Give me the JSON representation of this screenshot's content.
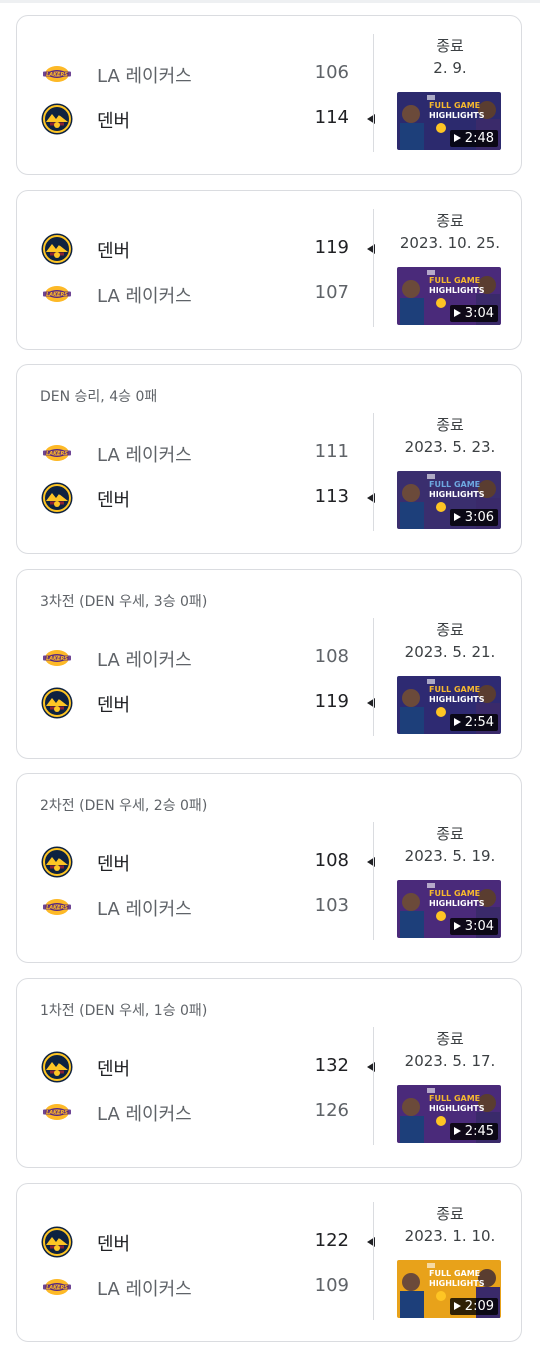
{
  "games": [
    {
      "label": "",
      "status": "종료",
      "date": "2. 9.",
      "teams": [
        {
          "name": "LA 레이커스",
          "score": "106",
          "logo": "lakers-logo",
          "winner": false
        },
        {
          "name": "덴버",
          "score": "114",
          "logo": "nuggets-logo",
          "winner": true
        }
      ],
      "video": {
        "duration": "2:48",
        "line1": "FULL GAME",
        "line2": "HIGHLIGHTS",
        "bg": "#2c2a6e",
        "accent": "#f5b82e"
      }
    },
    {
      "label": "",
      "status": "종료",
      "date": "2023. 10. 25.",
      "teams": [
        {
          "name": "덴버",
          "score": "119",
          "logo": "nuggets-logo",
          "winner": true
        },
        {
          "name": "LA 레이커스",
          "score": "107",
          "logo": "lakers-logo",
          "winner": false
        }
      ],
      "video": {
        "duration": "3:04",
        "line1": "FULL GAME",
        "line2": "HIGHLIGHTS",
        "bg": "#4a2a7a",
        "accent": "#f5b82e"
      }
    },
    {
      "label": "DEN 승리, 4승 0패",
      "status": "종료",
      "date": "2023. 5. 23.",
      "teams": [
        {
          "name": "LA 레이커스",
          "score": "111",
          "logo": "lakers-logo",
          "winner": false
        },
        {
          "name": "덴버",
          "score": "113",
          "logo": "nuggets-logo",
          "winner": true
        }
      ],
      "video": {
        "duration": "3:06",
        "line1": "FULL GAME",
        "line2": "HIGHLIGHTS",
        "bg": "#3a2e6e",
        "accent": "#6ea8e0"
      }
    },
    {
      "label": "3차전 (DEN 우세, 3승 0패)",
      "status": "종료",
      "date": "2023. 5. 21.",
      "teams": [
        {
          "name": "LA 레이커스",
          "score": "108",
          "logo": "lakers-logo",
          "winner": false
        },
        {
          "name": "덴버",
          "score": "119",
          "logo": "nuggets-logo",
          "winner": true
        }
      ],
      "video": {
        "duration": "2:54",
        "line1": "FULL GAME",
        "line2": "HIGHLIGHTS",
        "bg": "#2e2a72",
        "accent": "#f5b82e"
      }
    },
    {
      "label": "2차전 (DEN 우세, 2승 0패)",
      "status": "종료",
      "date": "2023. 5. 19.",
      "teams": [
        {
          "name": "덴버",
          "score": "108",
          "logo": "nuggets-logo",
          "winner": true
        },
        {
          "name": "LA 레이커스",
          "score": "103",
          "logo": "lakers-logo",
          "winner": false
        }
      ],
      "video": {
        "duration": "3:04",
        "line1": "FULL GAME",
        "line2": "HIGHLIGHTS",
        "bg": "#4a2a7a",
        "accent": "#f5b82e"
      }
    },
    {
      "label": "1차전 (DEN 우세, 1승 0패)",
      "status": "종료",
      "date": "2023. 5. 17.",
      "teams": [
        {
          "name": "덴버",
          "score": "132",
          "logo": "nuggets-logo",
          "winner": true
        },
        {
          "name": "LA 레이커스",
          "score": "126",
          "logo": "lakers-logo",
          "winner": false
        }
      ],
      "video": {
        "duration": "2:45",
        "line1": "FULL GAME",
        "line2": "HIGHLIGHTS",
        "bg": "#4a2a7a",
        "accent": "#f5b82e"
      }
    },
    {
      "label": "",
      "status": "종료",
      "date": "2023. 1. 10.",
      "teams": [
        {
          "name": "덴버",
          "score": "122",
          "logo": "nuggets-logo",
          "winner": true
        },
        {
          "name": "LA 레이커스",
          "score": "109",
          "logo": "lakers-logo",
          "winner": false
        }
      ],
      "video": {
        "duration": "2:09",
        "line1": "FULL GAME",
        "line2": "HIGHLIGHTS",
        "bg": "#e8a21a",
        "accent": "#ffffff"
      }
    }
  ],
  "colors": {
    "lakers_purple": "#552583",
    "lakers_gold": "#fdb927",
    "nuggets_navy": "#0e2240",
    "nuggets_gold": "#fec524",
    "border": "#dadce0"
  }
}
